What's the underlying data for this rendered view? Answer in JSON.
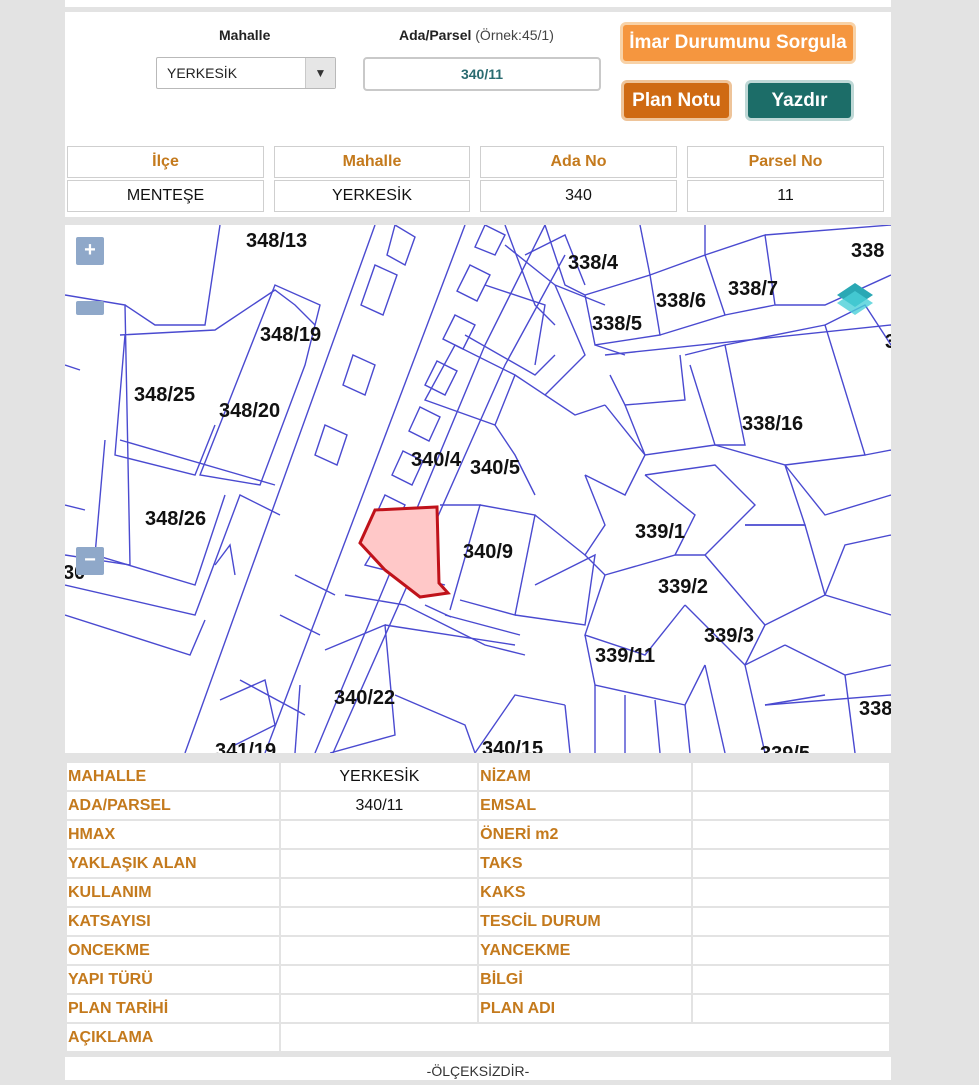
{
  "query_form": {
    "mahalle_label": "Mahalle",
    "mahalle_selected": "YERKESİK",
    "ada_parsel_label": "Ada/Parsel",
    "ada_parsel_hint": "(Örnek:45/1)",
    "ada_parsel_value": "340/11",
    "imar_button": "İmar Durumunu Sorgula",
    "plan_notu_button": "Plan Notu",
    "yazdir_button": "Yazdır"
  },
  "summary": {
    "headers": [
      "İlçe",
      "Mahalle",
      "Ada No",
      "Parsel No"
    ],
    "values": [
      "MENTEŞE",
      "YERKESİK",
      "340",
      "11"
    ]
  },
  "map": {
    "zoom_in": "+",
    "zoom_out": "−",
    "parcel_labels": [
      "348/13",
      "338/4",
      "338",
      "338/6",
      "338/7",
      "338/5",
      "348/19",
      "348/25",
      "348/20",
      "338/16",
      "340/4",
      "340/5",
      "348/26",
      "340/9",
      "339/1",
      "30",
      "339/2",
      "339/3",
      "339/11",
      "340/22",
      "338",
      "341/19",
      "340/15",
      "339/5",
      "3"
    ],
    "highlight_color": "#ffc8c8",
    "highlight_border": "#c0121a",
    "line_color": "#4a4ad0"
  },
  "attributes": {
    "rows": [
      {
        "k1": "MAHALLE",
        "v1": "YERKESİK",
        "k2": "NİZAM",
        "v2": ""
      },
      {
        "k1": "ADA/PARSEL",
        "v1": "340/11",
        "k2": "EMSAL",
        "v2": ""
      },
      {
        "k1": "HMAX",
        "v1": "",
        "k2": "ÖNERİ m2",
        "v2": ""
      },
      {
        "k1": "YAKLAŞIK ALAN",
        "v1": "",
        "k2": "TAKS",
        "v2": ""
      },
      {
        "k1": "KULLANIM",
        "v1": "",
        "k2": "KAKS",
        "v2": ""
      },
      {
        "k1": "KATSAYISI",
        "v1": "",
        "k2": "TESCİL DURUM",
        "v2": ""
      },
      {
        "k1": "ONCEKME",
        "v1": "",
        "k2": "YANCEKME",
        "v2": ""
      },
      {
        "k1": "YAPI TÜRÜ",
        "v1": "",
        "k2": "BİLGİ",
        "v2": ""
      },
      {
        "k1": "PLAN TARİHİ",
        "v1": "",
        "k2": "PLAN ADI",
        "v2": ""
      }
    ],
    "aciklama_label": "AÇIKLAMA",
    "aciklama_value": ""
  },
  "footer_text": "-ÖLÇEKSİZDİR-"
}
